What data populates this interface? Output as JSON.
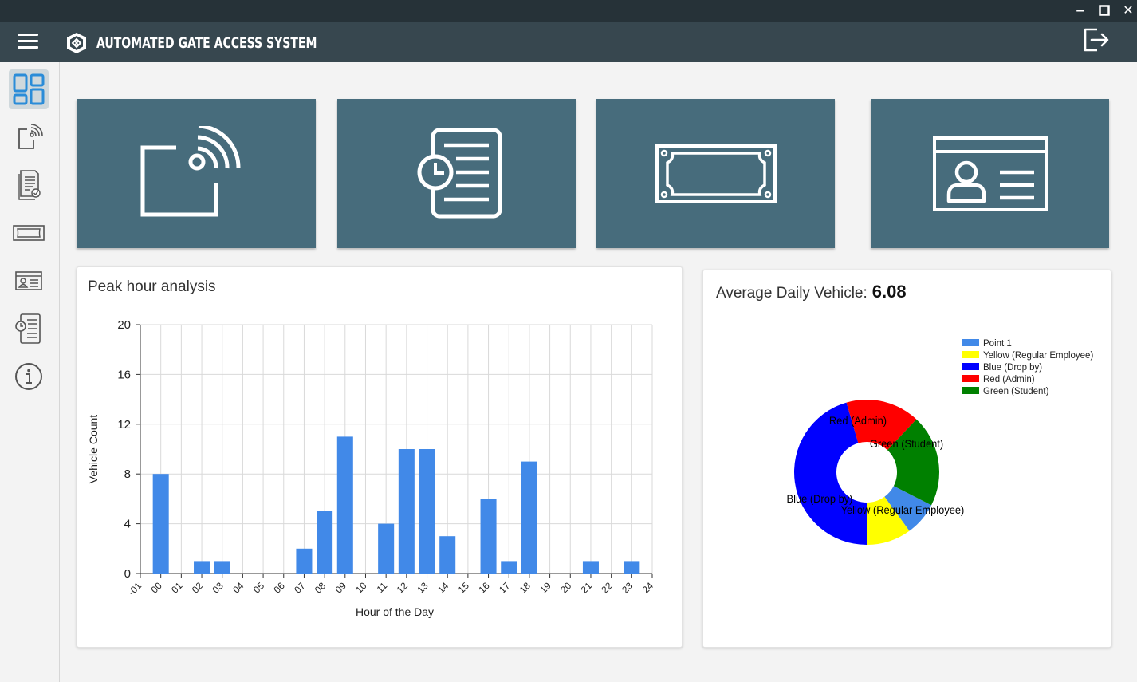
{
  "window": {
    "minimize": "‒",
    "maximize": "☐",
    "close": "✕"
  },
  "app": {
    "title": "AUTOMATED GATE ACCESS SYSTEM"
  },
  "sidebar": {
    "items": [
      {
        "icon": "dashboard-icon",
        "active": true
      },
      {
        "icon": "rfid-icon"
      },
      {
        "icon": "report-icon"
      },
      {
        "icon": "ticket-icon"
      },
      {
        "icon": "id-card-icon"
      },
      {
        "icon": "schedule-list-icon"
      },
      {
        "icon": "info-icon"
      }
    ]
  },
  "tiles": [
    {
      "icon": "rfid-reader-icon"
    },
    {
      "icon": "time-log-icon"
    },
    {
      "icon": "ticket-icon"
    },
    {
      "icon": "id-card-icon"
    }
  ],
  "peak": {
    "title": "Peak hour analysis",
    "chart_data": {
      "type": "bar",
      "title": "Peak hour analysis",
      "xlabel": "Hour of the Day",
      "ylabel": "Vehicle Count",
      "ylim": [
        0,
        20
      ],
      "yticks": [
        0,
        4,
        8,
        12,
        16,
        20
      ],
      "x_tick_labels": [
        "-01",
        "00",
        "01",
        "02",
        "03",
        "04",
        "05",
        "06",
        "07",
        "08",
        "09",
        "10",
        "11",
        "12",
        "13",
        "14",
        "15",
        "16",
        "17",
        "18",
        "19",
        "20",
        "21",
        "22",
        "23",
        "24"
      ],
      "categories": [
        "00",
        "01",
        "02",
        "03",
        "04",
        "05",
        "06",
        "07",
        "08",
        "09",
        "10",
        "11",
        "12",
        "13",
        "14",
        "15",
        "16",
        "17",
        "18",
        "19",
        "20",
        "21",
        "22",
        "23"
      ],
      "values": [
        8,
        0,
        1,
        1,
        0,
        0,
        0,
        2,
        5,
        11,
        0,
        4,
        10,
        10,
        3,
        0,
        6,
        1,
        9,
        0,
        0,
        1,
        0,
        1
      ],
      "bar_color": "#4189e8",
      "grid": true
    }
  },
  "avg": {
    "label": "Average Daily Vehicle:",
    "value": "6.08",
    "chart_data": {
      "type": "pie",
      "style": "doughnut",
      "legend_position": "top-right",
      "legend": [
        "Point 1",
        "Yellow (Regular Employee)",
        "Blue (Drop by)",
        "Red (Admin)",
        "Green (Student)"
      ],
      "slices": [
        {
          "label": "Point 1",
          "value": 0.075,
          "color": "#4189e8"
        },
        {
          "label": "Yellow (Regular Employee)",
          "value": 0.1,
          "color": "#ffff00"
        },
        {
          "label": "Blue (Drop by)",
          "value": 0.455,
          "color": "#0000ff"
        },
        {
          "label": "Red (Admin)",
          "value": 0.165,
          "color": "#ff0000"
        },
        {
          "label": "Green (Student)",
          "value": 0.205,
          "color": "#008000"
        }
      ]
    }
  }
}
